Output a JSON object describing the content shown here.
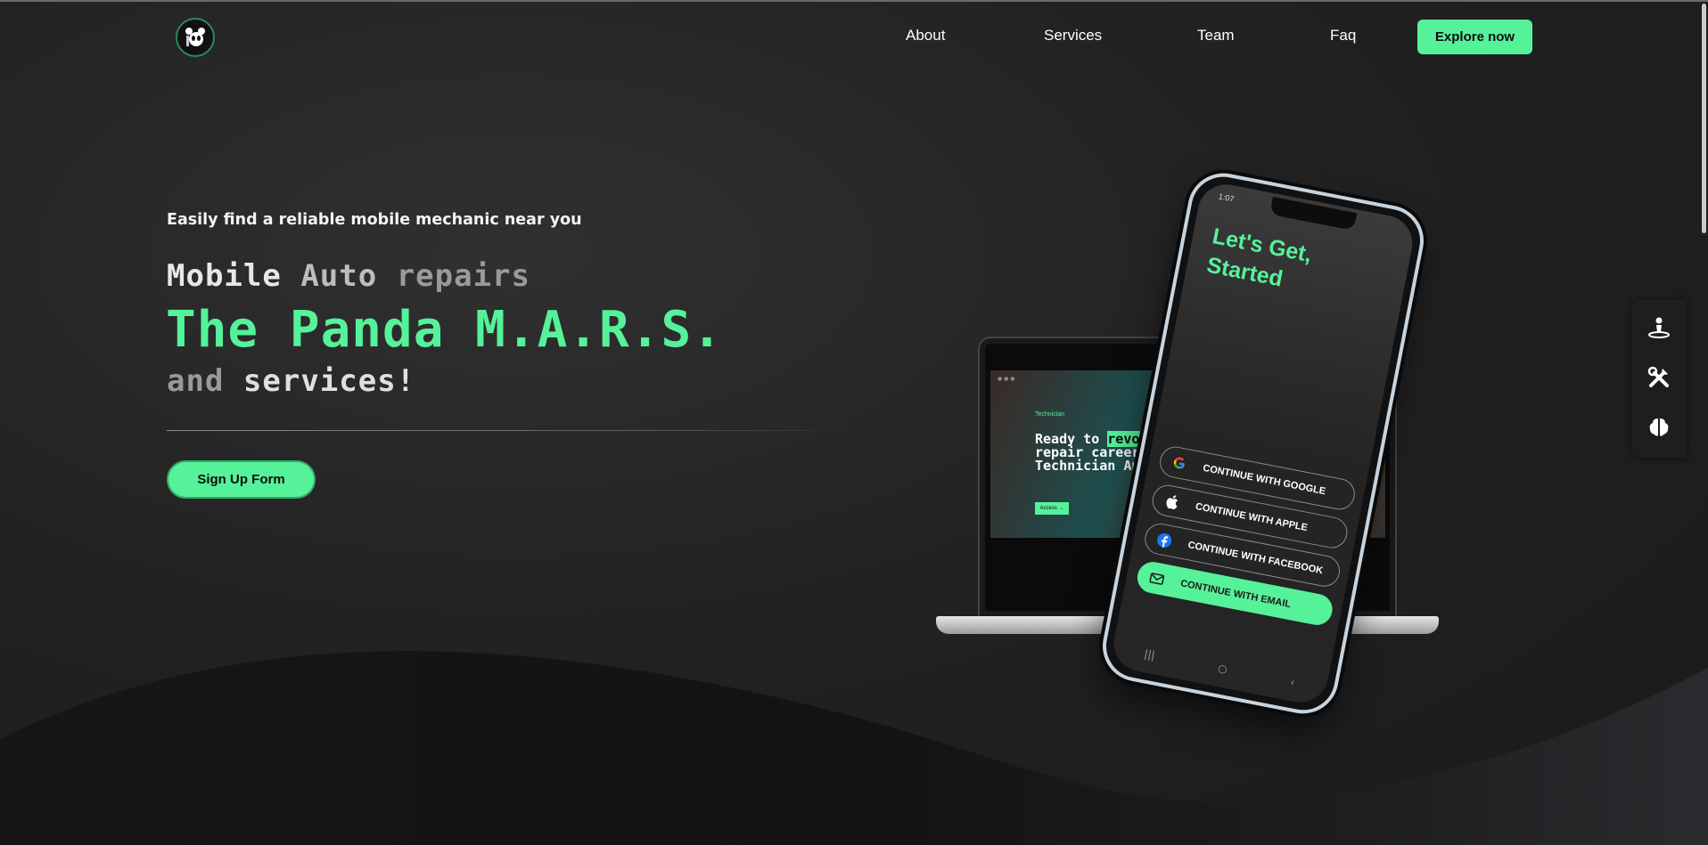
{
  "colors": {
    "accent": "#55f29a",
    "background": "#222222"
  },
  "header": {
    "logo_icon": "panda-logo",
    "nav": [
      "About",
      "Services",
      "Team",
      "Faq"
    ],
    "cta_label": "Explore now"
  },
  "hero": {
    "tagline": "Easily find a reliable mobile mechanic near you",
    "line1": [
      "Mobile",
      "Auto",
      "repairs"
    ],
    "title": "The Panda M.A.R.S.",
    "line3": [
      "and",
      "services!"
    ],
    "signup_label": "Sign Up Form"
  },
  "laptop": {
    "brand": "Technician",
    "text_before": "Ready to ",
    "text_highlight": "revoluti",
    "text_after": "repair career wit\nTechnician App?",
    "button": "Access →"
  },
  "phone": {
    "time": "1:07",
    "title": "Let's Get, Started",
    "buttons": [
      {
        "label": "CONTINUE WITH GOOGLE",
        "icon": "google-icon"
      },
      {
        "label": "CONTINUE WITH APPLE",
        "icon": "apple-icon"
      },
      {
        "label": "CONTINUE WITH FACEBOOK",
        "icon": "facebook-icon"
      },
      {
        "label": "CONTINUE WITH EMAIL",
        "icon": "mail-icon"
      }
    ],
    "nav_icons": [
      "recent-apps-icon",
      "home-icon",
      "back-icon"
    ]
  },
  "sidebar": {
    "icons": [
      "person-location-icon",
      "tools-icon",
      "brain-icon"
    ]
  }
}
